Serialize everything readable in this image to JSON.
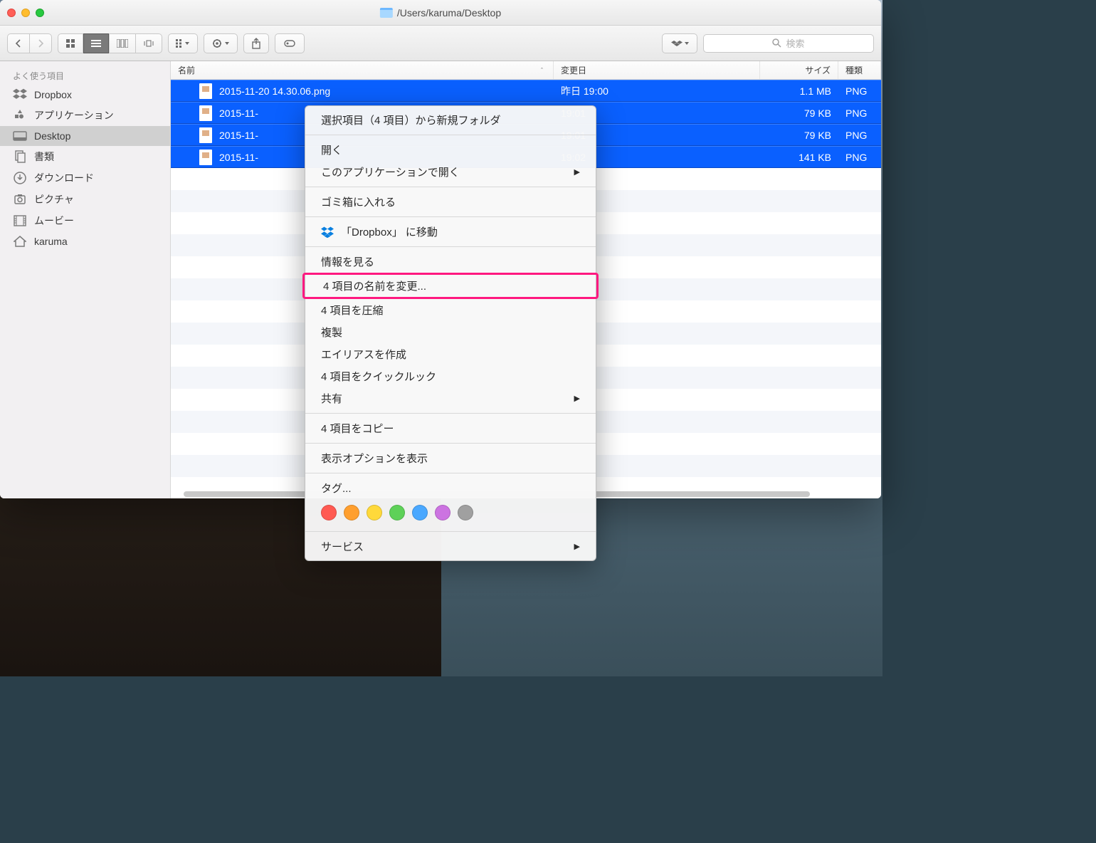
{
  "window": {
    "title_path": "/Users/karuma/Desktop",
    "search_placeholder": "検索"
  },
  "sidebar": {
    "header": "よく使う項目",
    "items": [
      {
        "label": "Dropbox",
        "icon": "dropbox"
      },
      {
        "label": "アプリケーション",
        "icon": "apps"
      },
      {
        "label": "Desktop",
        "icon": "desktop",
        "selected": true
      },
      {
        "label": "書類",
        "icon": "docs"
      },
      {
        "label": "ダウンロード",
        "icon": "downloads"
      },
      {
        "label": "ピクチャ",
        "icon": "pictures"
      },
      {
        "label": "ムービー",
        "icon": "movies"
      },
      {
        "label": "karuma",
        "icon": "home"
      }
    ]
  },
  "columns": {
    "name": "名前",
    "date": "変更日",
    "size": "サイズ",
    "kind": "種類"
  },
  "files": [
    {
      "name": "2015-11-20 14.30.06.png",
      "date": "昨日 19:00",
      "size": "1.1 MB",
      "kind": "PNG"
    },
    {
      "name": "2015-11-",
      "date": "19:01",
      "size": "79 KB",
      "kind": "PNG"
    },
    {
      "name": "2015-11-",
      "date": "19:01",
      "size": "79 KB",
      "kind": "PNG"
    },
    {
      "name": "2015-11-",
      "date": "19:02",
      "size": "141 KB",
      "kind": "PNG"
    }
  ],
  "context_menu": {
    "new_folder": "選択項目（4 項目）から新規フォルダ",
    "open": "開く",
    "open_with": "このアプリケーションで開く",
    "trash": "ゴミ箱に入れる",
    "move_dropbox": "「Dropbox」 に移動",
    "get_info": "情報を見る",
    "rename": "4 項目の名前を変更...",
    "compress": "4 項目を圧縮",
    "duplicate": "複製",
    "alias": "エイリアスを作成",
    "quicklook": "4 項目をクイックルック",
    "share": "共有",
    "copy": "4 項目をコピー",
    "view_options": "表示オプションを表示",
    "tags": "タグ...",
    "services": "サービス",
    "tag_colors": [
      "#ff5a52",
      "#ff9f2e",
      "#ffd93a",
      "#5ed158",
      "#4aa8ff",
      "#cc73e1",
      "#a0a0a0"
    ]
  }
}
